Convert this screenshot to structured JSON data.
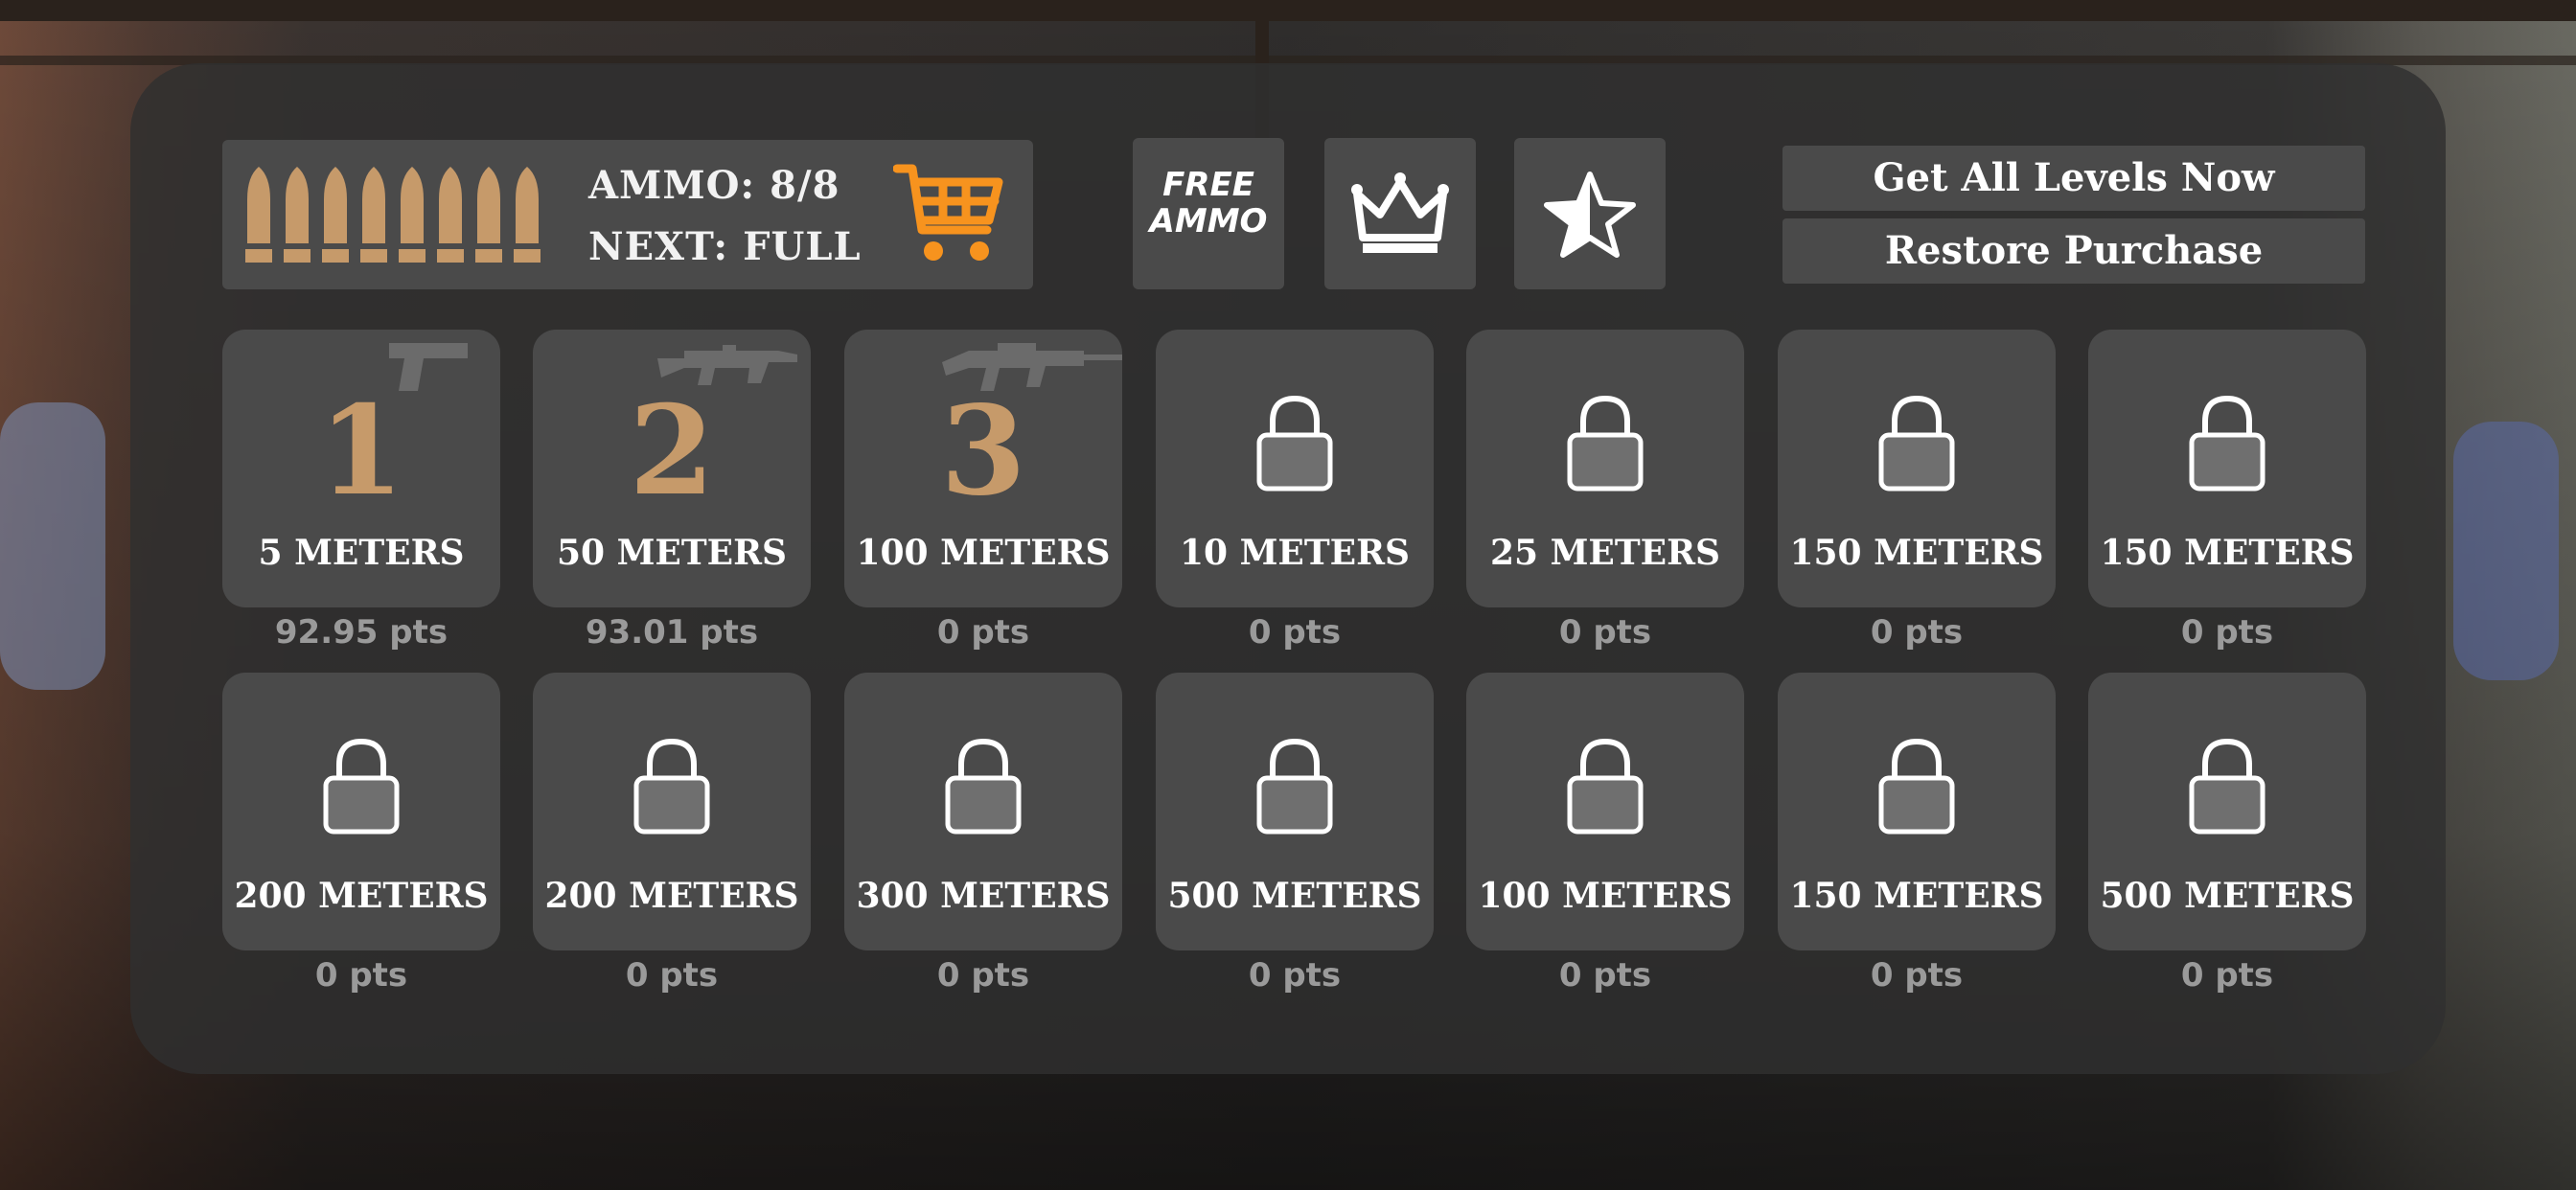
{
  "ammo": {
    "ammo_label": "AMMO: 8/8",
    "next_label": "NEXT:  FULL",
    "bullets": 8
  },
  "colors": {
    "accent_bullet": "#c69a6a",
    "cart": "#f7931e"
  },
  "top_buttons": {
    "free_ammo_line1": "FREE",
    "free_ammo_line2": "AMMO",
    "crown_icon": "crown-icon",
    "rate_icon": "half-star-icon",
    "get_all_levels": "Get All Levels Now",
    "restore_purchase": "Restore Purchase"
  },
  "levels": [
    {
      "number": "1",
      "distance": "5 METERS",
      "points": "92.95 pts",
      "locked": false,
      "weapon": "pistol-icon"
    },
    {
      "number": "2",
      "distance": "50 METERS",
      "points": "93.01 pts",
      "locked": false,
      "weapon": "assault-rifle-icon"
    },
    {
      "number": "3",
      "distance": "100 METERS",
      "points": "0 pts",
      "locked": false,
      "weapon": "machine-gun-icon"
    },
    {
      "distance": "10 METERS",
      "points": "0 pts",
      "locked": true
    },
    {
      "distance": "25 METERS",
      "points": "0 pts",
      "locked": true
    },
    {
      "distance": "150 METERS",
      "points": "0 pts",
      "locked": true
    },
    {
      "distance": "150 METERS",
      "points": "0 pts",
      "locked": true
    },
    {
      "distance": "200 METERS",
      "points": "0 pts",
      "locked": true
    },
    {
      "distance": "200 METERS",
      "points": "0 pts",
      "locked": true
    },
    {
      "distance": "300 METERS",
      "points": "0 pts",
      "locked": true
    },
    {
      "distance": "500 METERS",
      "points": "0 pts",
      "locked": true
    },
    {
      "distance": "100 METERS",
      "points": "0 pts",
      "locked": true
    },
    {
      "distance": "150 METERS",
      "points": "0 pts",
      "locked": true
    },
    {
      "distance": "500 METERS",
      "points": "0 pts",
      "locked": true
    }
  ]
}
